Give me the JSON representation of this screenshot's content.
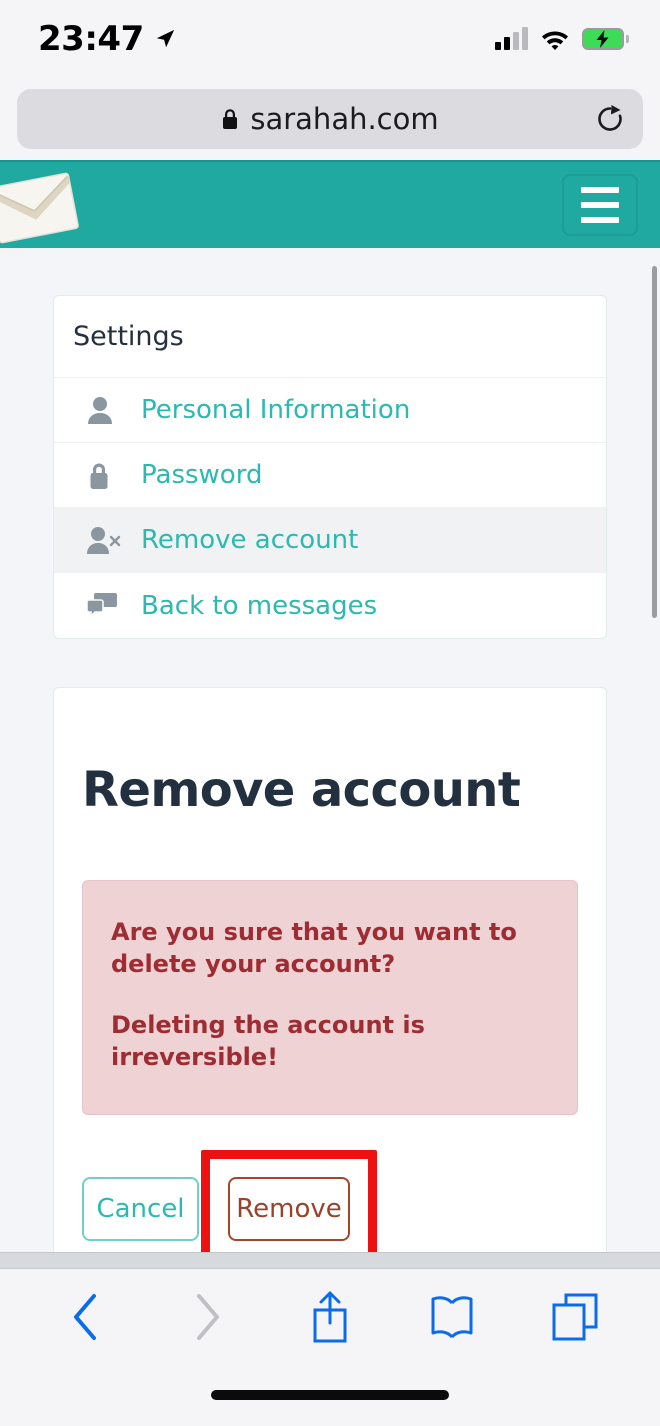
{
  "status_bar": {
    "time": "23:47",
    "location_icon": "location-arrow-icon",
    "signal_icon": "cellular-signal-icon",
    "wifi_icon": "wifi-icon",
    "battery_icon": "battery-charging-icon"
  },
  "browser": {
    "url": "sarahah.com",
    "lock_icon": "lock-icon",
    "reload_icon": "reload-icon",
    "toolbar": [
      {
        "name": "back-button",
        "icon": "chevron-left-icon",
        "enabled": true
      },
      {
        "name": "forward-button",
        "icon": "chevron-right-icon",
        "enabled": false
      },
      {
        "name": "share-button",
        "icon": "share-icon",
        "enabled": true
      },
      {
        "name": "bookmarks-button",
        "icon": "book-icon",
        "enabled": true
      },
      {
        "name": "tabs-button",
        "icon": "tabs-icon",
        "enabled": true
      }
    ]
  },
  "site_header": {
    "logo_icon": "envelope-logo-icon",
    "menu_button_icon": "hamburger-menu-icon",
    "background_color": "#1fa9a0"
  },
  "settings_card": {
    "title": "Settings",
    "items": [
      {
        "label": "Personal Information",
        "icon": "user-icon",
        "active": false
      },
      {
        "label": "Password",
        "icon": "lock-icon",
        "active": false
      },
      {
        "label": "Remove account",
        "icon": "user-times-icon",
        "active": true
      },
      {
        "label": "Back to messages",
        "icon": "comments-icon",
        "active": false
      }
    ],
    "link_color": "#2bb9b0"
  },
  "remove_card": {
    "heading": "Remove account",
    "alert": {
      "line1": "Are you sure that you want to delete your account?",
      "line2": "Deleting the account is irreversible!",
      "background_color": "#eed2d4",
      "text_color": "#9e2c33"
    },
    "cancel_button": "Cancel",
    "remove_button": "Remove"
  },
  "annotation": {
    "target": "Remove",
    "color": "#ee1111"
  }
}
